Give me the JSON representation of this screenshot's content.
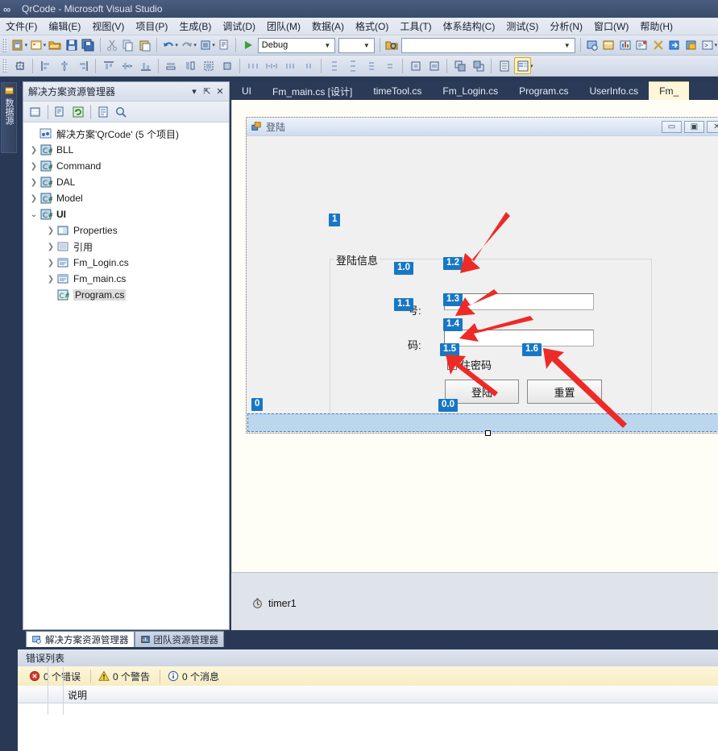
{
  "window": {
    "title": "QrCode - Microsoft Visual Studio",
    "logo_icon": "infinity-icon"
  },
  "menu": {
    "items": [
      {
        "label": "文件(F)",
        "name": "menu-file"
      },
      {
        "label": "编辑(E)",
        "name": "menu-edit"
      },
      {
        "label": "视图(V)",
        "name": "menu-view"
      },
      {
        "label": "项目(P)",
        "name": "menu-project"
      },
      {
        "label": "生成(B)",
        "name": "menu-build"
      },
      {
        "label": "调试(D)",
        "name": "menu-debug"
      },
      {
        "label": "团队(M)",
        "name": "menu-team"
      },
      {
        "label": "数据(A)",
        "name": "menu-data"
      },
      {
        "label": "格式(O)",
        "name": "menu-format"
      },
      {
        "label": "工具(T)",
        "name": "menu-tools"
      },
      {
        "label": "体系结构(C)",
        "name": "menu-architecture"
      },
      {
        "label": "测试(S)",
        "name": "menu-test"
      },
      {
        "label": "分析(N)",
        "name": "menu-analyze"
      },
      {
        "label": "窗口(W)",
        "name": "menu-window"
      },
      {
        "label": "帮助(H)",
        "name": "menu-help"
      }
    ]
  },
  "toolbar": {
    "config_combo_value": "Debug",
    "search_combo_value": "",
    "start_button_label": "▶"
  },
  "solution_explorer": {
    "title": "解决方案资源管理器",
    "dropdown_icon": "chevron-down-icon",
    "pin_icon": "pin-icon",
    "close_icon": "close-icon",
    "tree": {
      "root": "解决方案'QrCode' (5 个项目)",
      "projects": [
        {
          "label": "BLL",
          "icon": "csharp-project-icon"
        },
        {
          "label": "Command",
          "icon": "csharp-project-icon"
        },
        {
          "label": "DAL",
          "icon": "csharp-project-icon"
        },
        {
          "label": "Model",
          "icon": "csharp-project-icon"
        }
      ],
      "ui_project": "UI",
      "ui_children": [
        {
          "label": "Properties",
          "icon": "properties-icon",
          "expandable": true
        },
        {
          "label": "引用",
          "icon": "references-icon",
          "expandable": true
        },
        {
          "label": "Fm_Login.cs",
          "icon": "form-icon",
          "expandable": true
        },
        {
          "label": "Fm_main.cs",
          "icon": "form-icon",
          "expandable": true
        },
        {
          "label": "Program.cs",
          "icon": "csharp-file-icon",
          "expandable": false,
          "selected": true
        }
      ]
    },
    "tabs": [
      {
        "label": "解决方案资源管理器",
        "active": true,
        "icon": "solution-explorer-icon"
      },
      {
        "label": "团队资源管理器",
        "active": false,
        "icon": "team-explorer-icon"
      }
    ]
  },
  "left_dock": {
    "tab_label": "数据源",
    "tab_icon": "data-sources-icon"
  },
  "document_tabs": [
    {
      "label": "UI",
      "active": false
    },
    {
      "label": "Fm_main.cs [设计]",
      "active": false
    },
    {
      "label": "timeTool.cs",
      "active": false
    },
    {
      "label": "Fm_Login.cs",
      "active": false
    },
    {
      "label": "Program.cs",
      "active": false
    },
    {
      "label": "UserInfo.cs",
      "active": false
    },
    {
      "label": "Fm_",
      "active": true
    }
  ],
  "designer": {
    "form": {
      "title": "登陆",
      "icon": "winform-icon",
      "minimize_label": "▭",
      "maximize_label": "▣",
      "close_label": "✕"
    },
    "groupbox_label": "登陆信息",
    "label_account": "号:",
    "label_password": "码:",
    "textbox_account_value": "",
    "textbox_password_value": "",
    "checkbox_label": "住密码",
    "button_login": "登陆",
    "button_reset": "重置",
    "statusstrip_value": ""
  },
  "badges": [
    {
      "id": "1",
      "name": "badge-groupbox"
    },
    {
      "id": "1.0",
      "name": "badge-label-account"
    },
    {
      "id": "1.1",
      "name": "badge-label-password"
    },
    {
      "id": "1.2",
      "name": "badge-textbox-account"
    },
    {
      "id": "1.3",
      "name": "badge-textbox-password"
    },
    {
      "id": "1.4",
      "name": "badge-checkbox"
    },
    {
      "id": "1.5",
      "name": "badge-button-login"
    },
    {
      "id": "1.6",
      "name": "badge-button-reset"
    },
    {
      "id": "0",
      "name": "badge-statusstrip"
    },
    {
      "id": "0.0",
      "name": "badge-statuslabel"
    }
  ],
  "component_tray": {
    "item_label": "timer1",
    "item_icon": "timer-icon"
  },
  "error_list": {
    "title": "错误列表",
    "chips": [
      {
        "label": "0 个错误",
        "icon": "error-icon",
        "name": "errors-filter"
      },
      {
        "label": "0 个警告",
        "icon": "warning-icon",
        "name": "warnings-filter"
      },
      {
        "label": "0 个消息",
        "icon": "info-icon",
        "name": "messages-filter"
      }
    ],
    "columns": [
      "说明"
    ],
    "rows": []
  },
  "colors": {
    "accent_badge": "#1877c4",
    "arrow_red": "#e8262a",
    "titlebar": "#3b4c6b",
    "doc_tab_active": "#fdf6d9"
  }
}
